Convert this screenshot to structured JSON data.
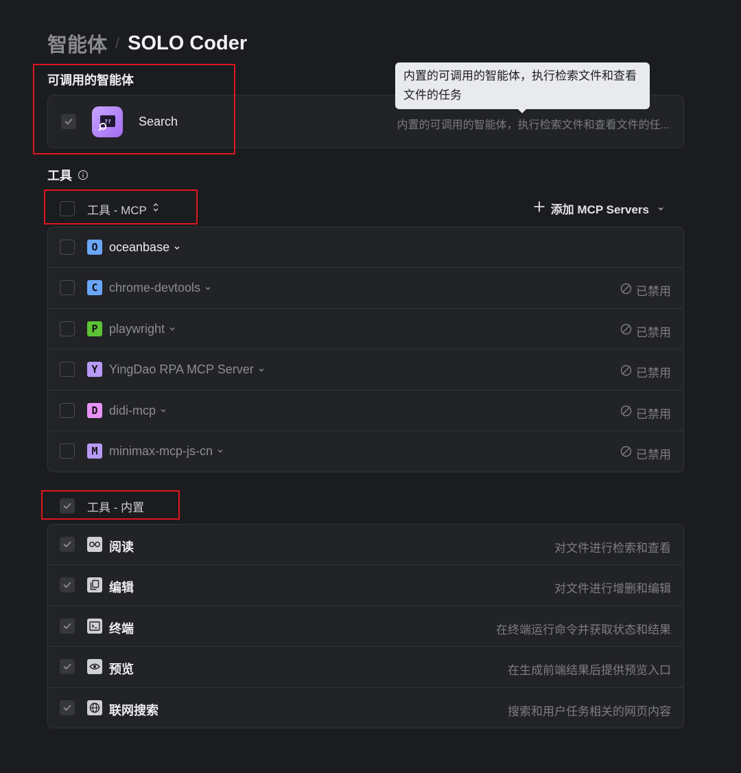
{
  "breadcrumb": {
    "parent": "智能体",
    "separator": "/",
    "current": "SOLO Coder"
  },
  "agents_section": {
    "title": "可调用的智能体",
    "items": [
      {
        "name": "Search",
        "description": "内置的可调用的智能体，执行检索文件和查看文件的任...",
        "checked": true,
        "icon": "search-agent-icon"
      }
    ]
  },
  "tooltip": {
    "text": "内置的可调用的智能体，执行检索文件和查看文件的任务"
  },
  "tools_section": {
    "title": "工具",
    "info_icon": "info-icon"
  },
  "mcp_group": {
    "label": "工具 - MCP",
    "add_button_label": "添加 MCP Servers",
    "servers": [
      {
        "letter": "O",
        "name": "oceanbase",
        "badge_color": "#6aa6f8",
        "enabled": true,
        "status": ""
      },
      {
        "letter": "C",
        "name": "chrome-devtools",
        "badge_color": "#6aa6f8",
        "enabled": false,
        "status": "已禁用"
      },
      {
        "letter": "P",
        "name": "playwright",
        "badge_color": "#5bc236",
        "enabled": false,
        "status": "已禁用"
      },
      {
        "letter": "Y",
        "name": "YingDao RPA MCP Server",
        "badge_color": "#b79af6",
        "enabled": false,
        "status": "已禁用"
      },
      {
        "letter": "D",
        "name": "didi-mcp",
        "badge_color": "#e792f5",
        "enabled": false,
        "status": "已禁用"
      },
      {
        "letter": "M",
        "name": "minimax-mcp-js-cn",
        "badge_color": "#b79af6",
        "enabled": false,
        "status": "已禁用"
      }
    ]
  },
  "builtin_group": {
    "label": "工具 - 内置",
    "tools": [
      {
        "name": "阅读",
        "description": "对文件进行检索和查看",
        "icon": "glasses-icon"
      },
      {
        "name": "编辑",
        "description": "对文件进行增删和编辑",
        "icon": "copy-icon"
      },
      {
        "name": "终端",
        "description": "在终端运行命令并获取状态和结果",
        "icon": "terminal-icon"
      },
      {
        "name": "预览",
        "description": "在生成前端结果后提供预览入口",
        "icon": "eye-icon"
      },
      {
        "name": "联网搜索",
        "description": "搜索和用户任务相关的网页内容",
        "icon": "globe-icon"
      }
    ]
  },
  "colors": {
    "background": "#1b1c1f",
    "card": "#222327",
    "highlight": "#e0141e"
  }
}
